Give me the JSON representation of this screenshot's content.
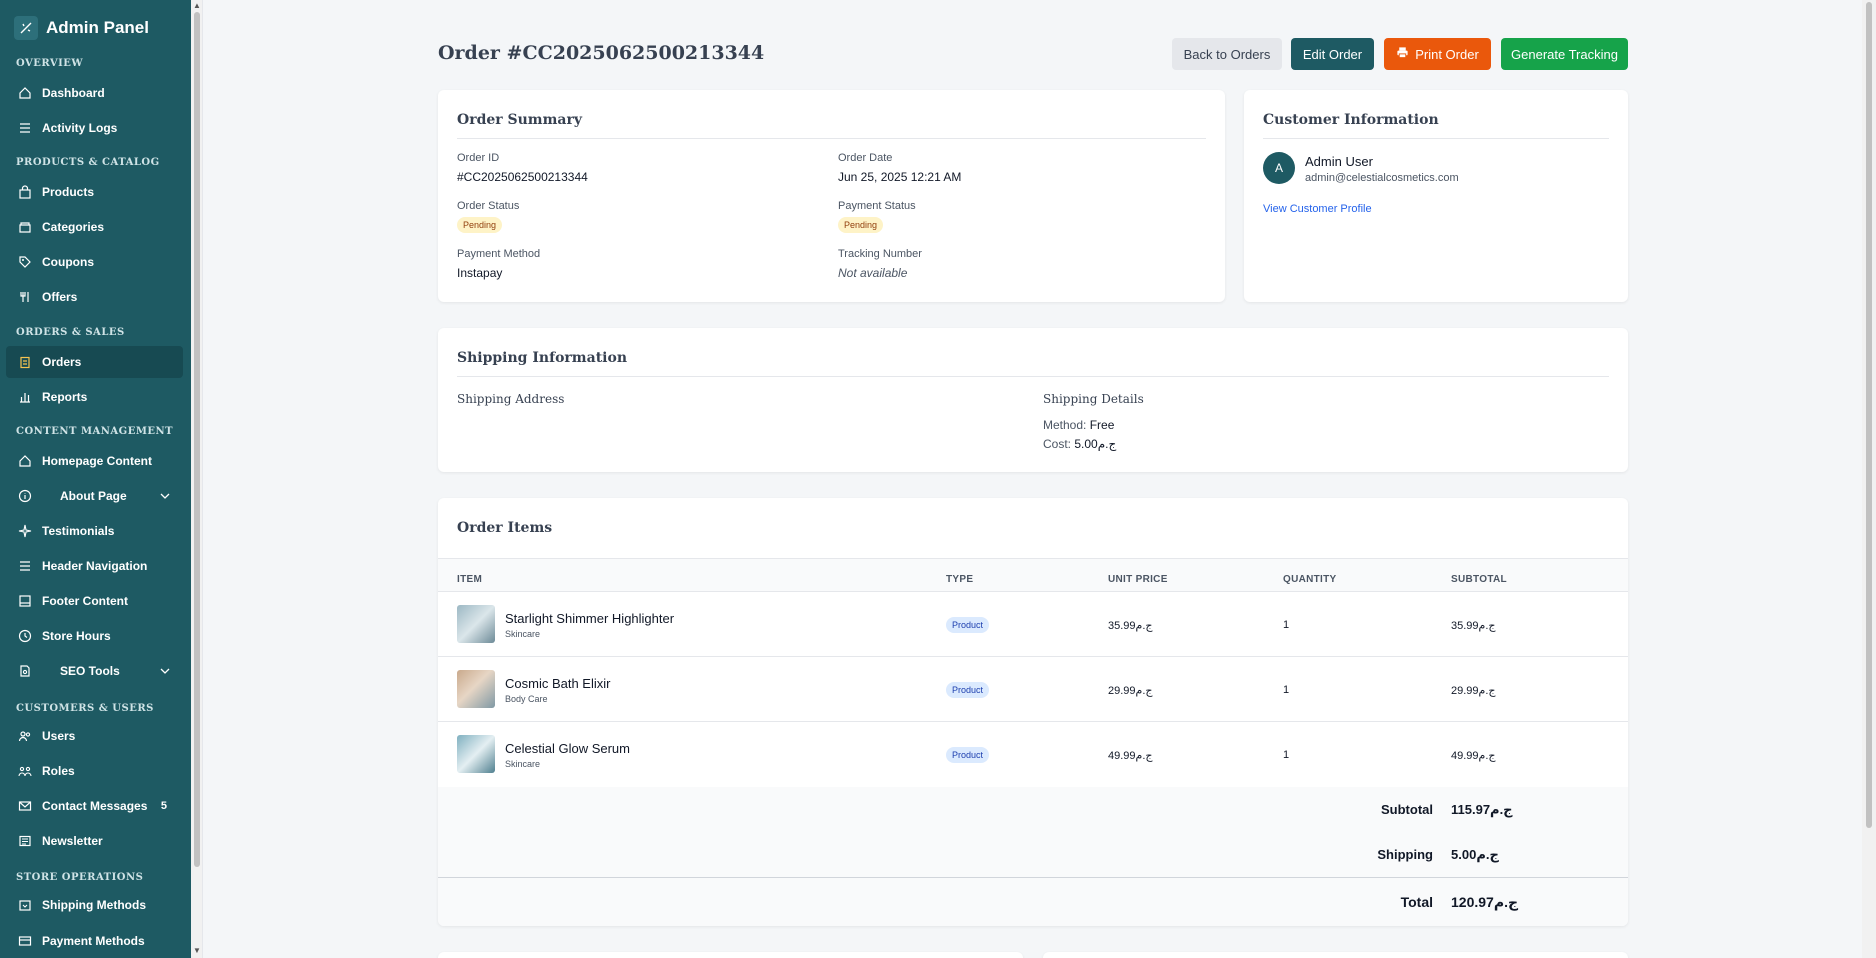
{
  "sidebar": {
    "brand": "Admin Panel",
    "sections": {
      "overview": "OVERVIEW",
      "products": "PRODUCTS & CATALOG",
      "orders": "ORDERS & SALES",
      "content": "CONTENT MANAGEMENT",
      "customers": "CUSTOMERS & USERS",
      "store": "STORE OPERATIONS"
    },
    "items": {
      "dashboard": "Dashboard",
      "activity_logs": "Activity Logs",
      "products": "Products",
      "categories": "Categories",
      "coupons": "Coupons",
      "offers": "Offers",
      "orders": "Orders",
      "reports": "Reports",
      "homepage_content": "Homepage Content",
      "about_page": "About Page",
      "testimonials": "Testimonials",
      "header_navigation": "Header Navigation",
      "footer_content": "Footer Content",
      "store_hours": "Store Hours",
      "seo_tools": "SEO Tools",
      "users": "Users",
      "roles": "Roles",
      "contact_messages": "Contact Messages",
      "contact_messages_badge": "5",
      "newsletter": "Newsletter",
      "shipping_methods": "Shipping Methods",
      "payment_methods": "Payment Methods"
    },
    "active": "orders"
  },
  "header": {
    "title": "Order #CC2025062500213344",
    "buttons": {
      "back": "Back to Orders",
      "edit": "Edit Order",
      "print": "Print Order",
      "tracking": "Generate Tracking"
    }
  },
  "summary": {
    "title": "Order Summary",
    "order_id_label": "Order ID",
    "order_id": "#CC2025062500213344",
    "order_date_label": "Order Date",
    "order_date": "Jun 25, 2025 12:21 AM",
    "order_status_label": "Order Status",
    "order_status": "Pending",
    "payment_status_label": "Payment Status",
    "payment_status": "Pending",
    "payment_method_label": "Payment Method",
    "payment_method": "Instapay",
    "tracking_label": "Tracking Number",
    "tracking": "Not available"
  },
  "customer": {
    "title": "Customer Information",
    "initial": "A",
    "name": "Admin User",
    "email": "admin@celestialcosmetics.com",
    "profile_link": "View Customer Profile"
  },
  "shipping": {
    "title": "Shipping Information",
    "address_heading": "Shipping Address",
    "details_heading": "Shipping Details",
    "method_label": "Method:",
    "method": "Free",
    "cost_label": "Cost:",
    "cost": "5.00ج.م"
  },
  "items": {
    "title": "Order Items",
    "columns": [
      "ITEM",
      "TYPE",
      "UNIT PRICE",
      "QUANTITY",
      "SUBTOTAL"
    ],
    "rows": [
      {
        "name": "Starlight Shimmer Highlighter",
        "category": "Skincare",
        "type": "Product",
        "unit_price": "35.99ج.م",
        "quantity": "1",
        "subtotal": "35.99ج.م"
      },
      {
        "name": "Cosmic Bath Elixir",
        "category": "Body Care",
        "type": "Product",
        "unit_price": "29.99ج.م",
        "quantity": "1",
        "subtotal": "29.99ج.م"
      },
      {
        "name": "Celestial Glow Serum",
        "category": "Skincare",
        "type": "Product",
        "unit_price": "49.99ج.م",
        "quantity": "1",
        "subtotal": "49.99ج.م"
      }
    ],
    "subtotal_label": "Subtotal",
    "subtotal": "115.97ج.م",
    "shipping_label": "Shipping",
    "shipping": "5.00ج.م",
    "total_label": "Total",
    "total": "120.97ج.م"
  },
  "colors": {
    "sidebar": "#1e5a63",
    "primary": "#1e5a63",
    "print": "#ea580c",
    "tracking": "#16a34a"
  }
}
